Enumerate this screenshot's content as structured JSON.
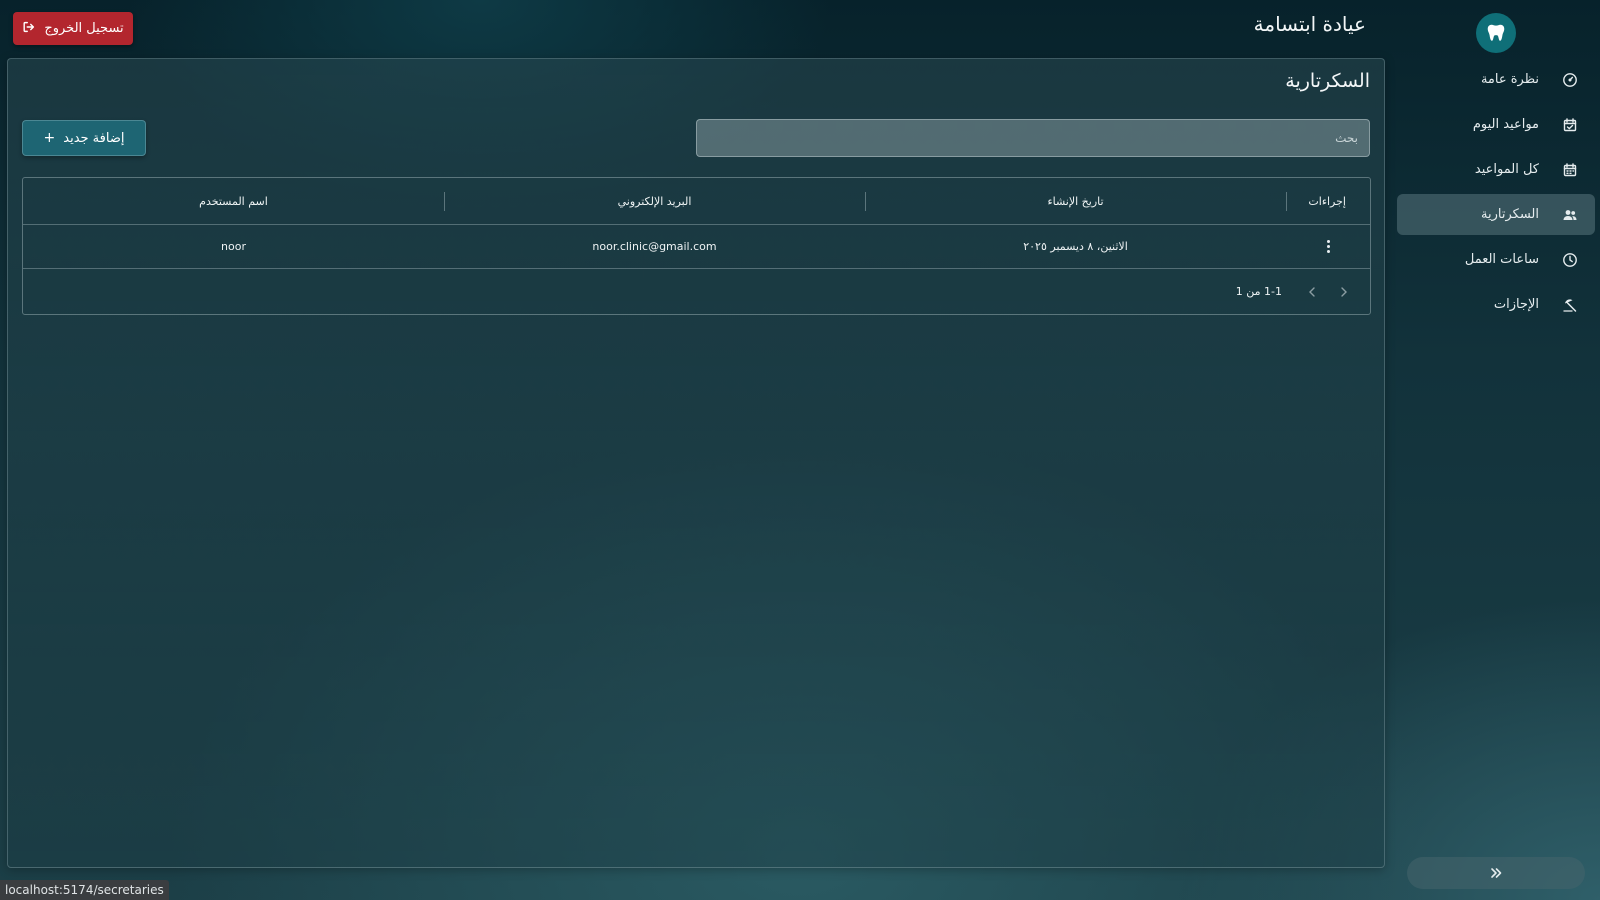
{
  "app": {
    "title": "عيادة ابتسامة"
  },
  "header": {
    "logout_label": "تسجيل الخروج"
  },
  "sidebar": {
    "items": [
      {
        "label": "نظرة عامة",
        "icon": "gauge-icon"
      },
      {
        "label": "مواعيد اليوم",
        "icon": "calendar-check-icon"
      },
      {
        "label": "كل المواعيد",
        "icon": "calendar-icon"
      },
      {
        "label": "السكرتارية",
        "icon": "users-icon",
        "active": true
      },
      {
        "label": "ساعات العمل",
        "icon": "clock-icon"
      },
      {
        "label": "الإجازات",
        "icon": "beach-umbrella-icon"
      }
    ]
  },
  "main": {
    "page_title": "السكرتارية",
    "search_placeholder": "بحث",
    "add_label": "إضافة جديد",
    "table": {
      "columns": {
        "actions": "إجراءات",
        "created": "تاريخ الإنشاء",
        "email": "البريد الإلكتروني",
        "username": "اسم المستخدم"
      },
      "rows": [
        {
          "created": "الاثنين، ٨ ديسمبر ٢٠٢٥",
          "email": "noor.clinic@gmail.com",
          "username": "noor"
        }
      ],
      "pagination": "1-1 من 1"
    }
  },
  "status_bar": {
    "url": "localhost:5174/secretaries"
  },
  "colors": {
    "logout_bg": "#b3262e",
    "add_bg": "#1e6573",
    "active_nav_bg": "#6f9099"
  }
}
